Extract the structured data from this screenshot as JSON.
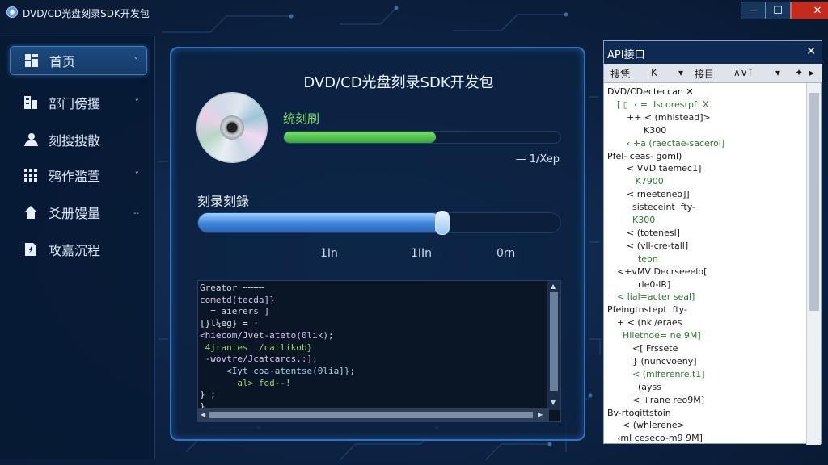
{
  "window": {
    "title": "DVD/CD光盘刻录SDK开发包",
    "controls": [
      "─",
      "☐",
      "✕"
    ]
  },
  "sidebar": {
    "items": [
      {
        "label": "首页",
        "icon": "dashboard-icon",
        "arrow": "˅",
        "active": true
      },
      {
        "label": "部门傍攫",
        "icon": "folder-icon",
        "arrow": "˅"
      },
      {
        "label": "刻搜搜散",
        "icon": "users-icon",
        "arrow": ""
      },
      {
        "label": "鸦作滥萱",
        "icon": "grid-icon",
        "arrow": "˅"
      },
      {
        "label": "爻册馒量",
        "icon": "home-icon",
        "arrow": "˗˗"
      },
      {
        "label": "攻嘉沉程",
        "icon": "document-icon",
        "arrow": ""
      }
    ]
  },
  "panel": {
    "title": "DVD/CD光盘刻录SDK开发包",
    "green_label": "统刻刷",
    "green_progress": 0.55,
    "speed_text": "— 1/Xep",
    "blue_label": "刻录刻錄",
    "blue_progress": 0.67,
    "ticks": [
      "1In",
      "1IIn",
      "0rn"
    ]
  },
  "code": {
    "lines": [
      {
        "text": "Greator ╍╍╍╍",
        "color": "#c8d2e0"
      },
      {
        "text": "cometd(tecda]}",
        "color": "#d8c6f0"
      },
      {
        "text": "  = aierers ]",
        "color": "#c8d2e0"
      },
      {
        "text": "[}l¼eg} = ·",
        "color": "#e6ecf4"
      },
      {
        "text": "<hiecom/Jvet-ateto(0lik);",
        "color": "#d8c6f0"
      },
      {
        "text": " 4jrantes ./catlikob}",
        "color": "#9ed17a"
      },
      {
        "text": " -wovtre/Jcatcarcs.:];",
        "color": "#d8c6f0"
      },
      {
        "text": "     <Iyt coa-atentse(0lia]};",
        "color": "#a8d4f6"
      },
      {
        "text": "       al> fod--!",
        "color": "#9ed17a"
      },
      {
        "text": "} ;",
        "color": "#e6ecf4"
      },
      {
        "text": "}",
        "color": "#e6ecf4"
      }
    ]
  },
  "api": {
    "title": "API接口",
    "close": "✕",
    "tools": [
      "搜凭",
      "K",
      "▾",
      "接目",
      "⊼⊽⊺",
      "▾",
      "✦",
      "▸"
    ],
    "tree": [
      {
        "text": "DVD/CDecteccan ✕",
        "indent": 0
      },
      {
        "text": "[ ▯  ‹ =  Iscoresrpf  X",
        "indent": 1
      },
      {
        "text": "++ < (mhistead]>",
        "indent": 2
      },
      {
        "text": "      K300",
        "indent": 2
      },
      {
        "text": "‹ +a (raectae-sacerol]",
        "indent": 2
      },
      {
        "text": "Pfel- ceas- goml)",
        "indent": 0
      },
      {
        "text": "< VVD taemec1]",
        "indent": 2
      },
      {
        "text": "   K7900",
        "indent": 2
      },
      {
        "text": "< rneeteneo]]",
        "indent": 2
      },
      {
        "text": "  sisteceint  fty-",
        "indent": 2
      },
      {
        "text": "  K300",
        "indent": 2
      },
      {
        "text": "< (totenesl]",
        "indent": 2
      },
      {
        "text": "< (vll-cre-tall]",
        "indent": 2
      },
      {
        "text": "    teon",
        "indent": 2
      },
      {
        "text": "<+vMV Decrseeelo[",
        "indent": 1
      },
      {
        "text": "    rle0-lR]",
        "indent": 2
      },
      {
        "text": "< lial=acter seal]",
        "indent": 1
      },
      {
        "text": "Pfeingtnstept  fty-",
        "indent": 0
      },
      {
        "text": "+ < (nkl/eraes",
        "indent": 1
      },
      {
        "text": "  Hiletnoe= ne 9M]",
        "indent": 1
      },
      {
        "text": "  <[ Frssete",
        "indent": 2
      },
      {
        "text": "  } (nuncvoeny]",
        "indent": 2
      },
      {
        "text": "  < (mlferenre.t1]",
        "indent": 2
      },
      {
        "text": "    (ayss",
        "indent": 2
      },
      {
        "text": "  < +rane reo9M]",
        "indent": 2
      },
      {
        "text": "Bv-rtogittstoin",
        "indent": 0
      },
      {
        "text": "  < (whlerene>",
        "indent": 1
      },
      {
        "text": "‹ml ceseco-m9 9M]",
        "indent": 1
      }
    ]
  }
}
